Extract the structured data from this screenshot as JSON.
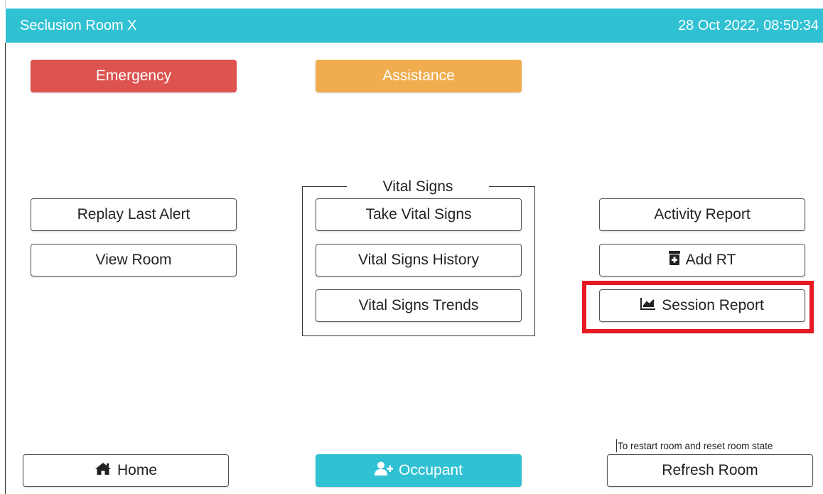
{
  "header": {
    "title": "Seclusion Room X",
    "datetime": "28 Oct 2022, 08:50:34"
  },
  "alerts": {
    "emergency_label": "Emergency",
    "assistance_label": "Assistance"
  },
  "left_actions": {
    "replay_label": "Replay Last Alert",
    "view_room_label": "View Room"
  },
  "vital_signs": {
    "legend": "Vital Signs",
    "take_label": "Take Vital Signs",
    "history_label": "Vital Signs History",
    "trends_label": "Vital Signs Trends"
  },
  "right_actions": {
    "activity_label": "Activity Report",
    "add_rt_label": "Add RT",
    "session_label": "Session Report"
  },
  "footer": {
    "home_label": "Home",
    "occupant_label": "Occupant",
    "refresh_hint": "To restart room and reset room state",
    "refresh_label": "Refresh Room"
  },
  "colors": {
    "header_bg": "#30c1d3",
    "emergency": "#dc5350",
    "assistance": "#f0ad4e",
    "occupant": "#30c1d3",
    "highlight": "#e51a22"
  },
  "icons": {
    "add_rt": "medicine-bottle-icon",
    "session_report": "line-chart-icon",
    "home": "home-icon",
    "occupant": "user-plus-icon"
  }
}
